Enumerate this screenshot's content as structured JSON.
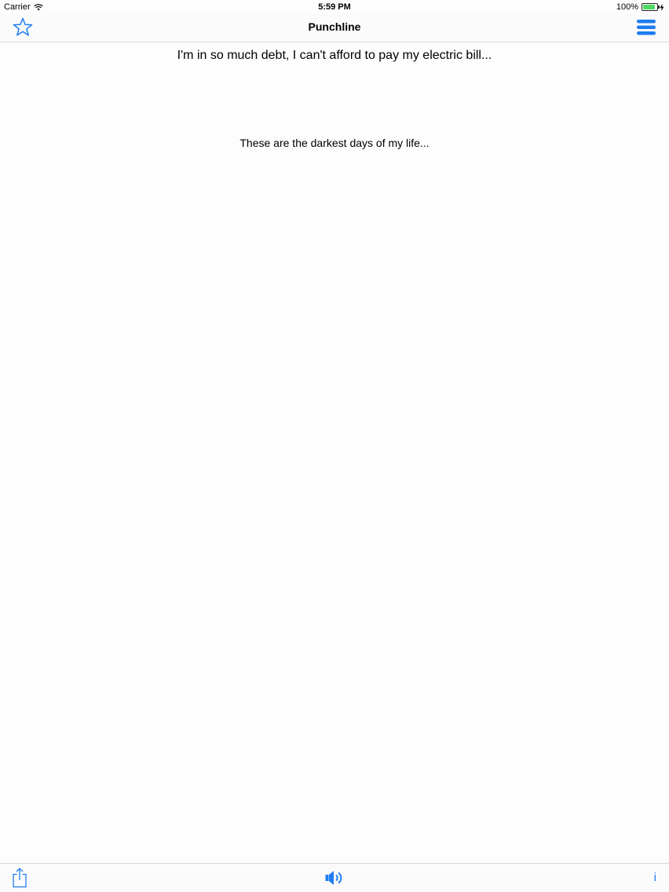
{
  "status_bar": {
    "carrier": "Carrier",
    "time": "5:59 PM",
    "battery_percent": "100%"
  },
  "nav": {
    "title": "Punchline",
    "left_icon": "star-icon",
    "right_icon": "menu-icon"
  },
  "joke": {
    "setup": "I'm in so much debt, I can't afford to pay my electric bill...",
    "punchline": "These are the darkest days of my life..."
  },
  "toolbar": {
    "left_icon": "share-icon",
    "center_icon": "speaker-icon",
    "info_label": "i"
  },
  "colors": {
    "accent": "#1f7cf0",
    "battery": "#4cd964"
  }
}
